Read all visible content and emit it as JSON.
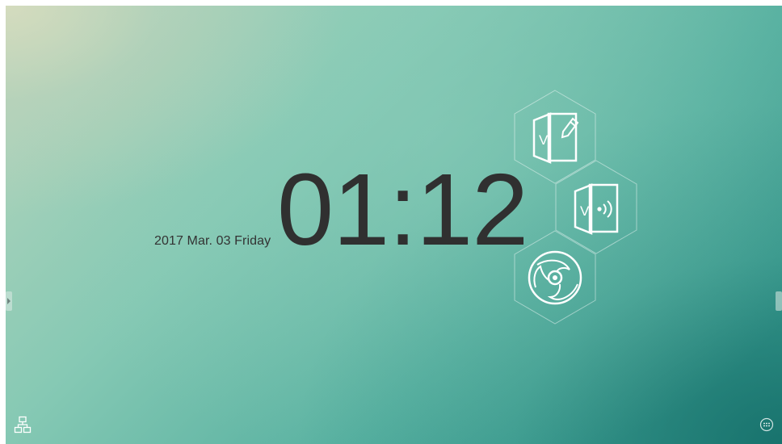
{
  "home": {
    "date": "2017 Mar. 03 Friday",
    "time": "01:12"
  },
  "tiles": [
    {
      "name": "whiteboard",
      "icon": "whiteboard-app-icon",
      "letter": "V"
    },
    {
      "name": "wireless-display",
      "icon": "wireless-display-icon",
      "letter": "V"
    },
    {
      "name": "browser",
      "icon": "browser-app-icon"
    }
  ],
  "icons": {
    "left_handle": "left-sidebar-handle",
    "right_handle": "right-sidebar-handle",
    "network": "network-icon",
    "apps": "app-grid-icon"
  },
  "colors": {
    "text": "#303030",
    "icon_stroke": "#ffffff",
    "bg_light": "#b9d6bd",
    "bg_dark": "#2f8f86"
  }
}
